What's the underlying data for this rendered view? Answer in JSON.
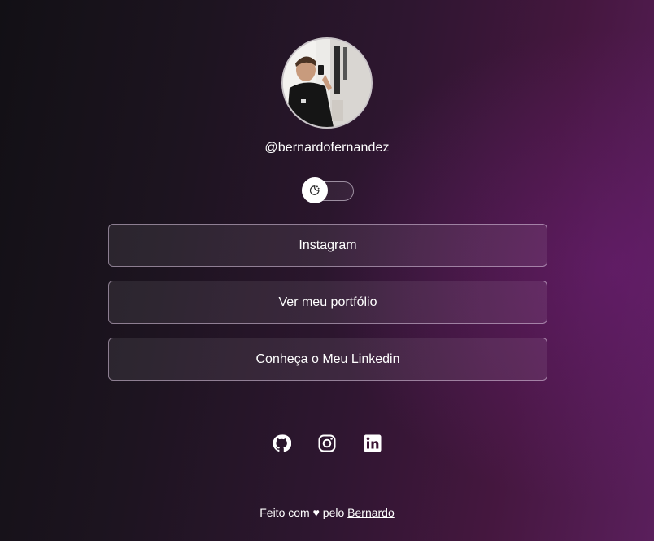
{
  "profile": {
    "handle": "@bernardofernandez"
  },
  "theme_toggle": {
    "icon": "moon-sun-icon"
  },
  "links": [
    {
      "label": "Instagram"
    },
    {
      "label": "Ver meu portfólio"
    },
    {
      "label": "Conheça o Meu Linkedin"
    }
  ],
  "socials": [
    {
      "icon": "github-icon"
    },
    {
      "icon": "instagram-icon"
    },
    {
      "icon": "linkedin-icon"
    }
  ],
  "footer": {
    "prefix": "Feito com ♥ pelo ",
    "author": "Bernardo"
  },
  "colors": {
    "background_left": "#121015",
    "background_right": "#5a1f5c",
    "text": "#ffffff"
  }
}
